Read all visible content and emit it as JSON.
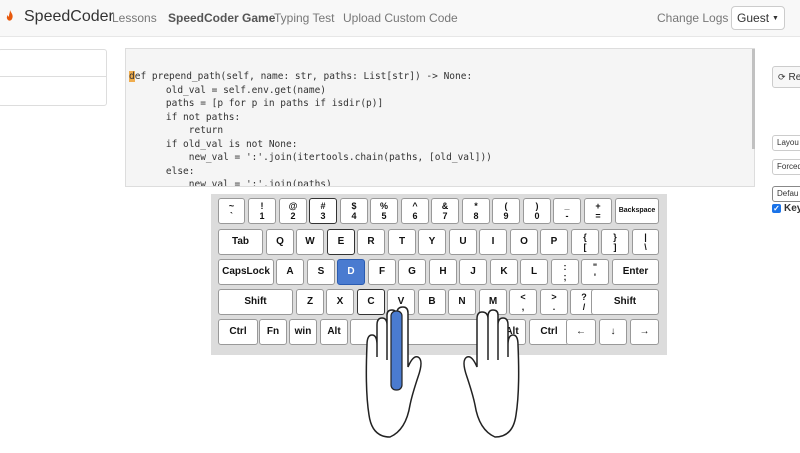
{
  "nav": {
    "brand": "SpeedCoder",
    "links": [
      "Lessons",
      "SpeedCoder Game",
      "Typing Test",
      "Upload Custom Code"
    ],
    "changelogs": "Change Logs",
    "guest": "Guest"
  },
  "code": {
    "first_char": "d",
    "lines": [
      "ef prepend_path(self, name: str, paths: List[str]) -> None:",
      "    old_val = self.env.get(name)",
      "    paths = [p for p in paths if isdir(p)]",
      "    if not paths:",
      "        return",
      "    if old_val is not None:",
      "        new_val = ':'.join(itertools.chain(paths, [old_val]))",
      "    else:",
      "        new_val = ':'.join(paths)"
    ]
  },
  "right_panel": {
    "reset_label": "Re",
    "layout_label": "Layou",
    "forced_label": "Forced",
    "default_label": "Defau",
    "keyboard_label": "Key"
  },
  "keyboard": {
    "highlight_key": "D",
    "row1": [
      {
        "top": "~",
        "bottom": "`"
      },
      {
        "top": "!",
        "bottom": "1"
      },
      {
        "top": "@",
        "bottom": "2"
      },
      {
        "top": "#",
        "bottom": "3"
      },
      {
        "top": "$",
        "bottom": "4"
      },
      {
        "top": "%",
        "bottom": "5"
      },
      {
        "top": "^",
        "bottom": "6"
      },
      {
        "top": "&",
        "bottom": "7"
      },
      {
        "top": "*",
        "bottom": "8"
      },
      {
        "top": "(",
        "bottom": "9"
      },
      {
        "top": ")",
        "bottom": "0"
      },
      {
        "top": "_",
        "bottom": "-"
      },
      {
        "top": "+",
        "bottom": "="
      }
    ],
    "backspace": "Backspace",
    "tab": "Tab",
    "row2": [
      "Q",
      "W",
      "E",
      "R",
      "T",
      "Y",
      "U",
      "I",
      "O",
      "P"
    ],
    "row2_sym": [
      {
        "top": "{",
        "bottom": "["
      },
      {
        "top": "}",
        "bottom": "]"
      },
      {
        "top": "|",
        "bottom": "\\"
      }
    ],
    "capslock": "CapsLock",
    "row3": [
      "A",
      "S",
      "D",
      "F",
      "G",
      "H",
      "J",
      "K",
      "L"
    ],
    "row3_sym": [
      {
        "top": ":",
        "bottom": ";"
      },
      {
        "top": "\"",
        "bottom": "'"
      }
    ],
    "enter": "Enter",
    "shift": "Shift",
    "row4": [
      "Z",
      "X",
      "C",
      "V",
      "B",
      "N",
      "M"
    ],
    "row4_sym": [
      {
        "top": "<",
        "bottom": ","
      },
      {
        "top": ">",
        "bottom": "."
      },
      {
        "top": "?",
        "bottom": "/"
      }
    ],
    "ctrl": "Ctrl",
    "fn": "Fn",
    "win": "win",
    "alt": "Alt",
    "arrows": [
      "←",
      "↓",
      "→"
    ]
  }
}
